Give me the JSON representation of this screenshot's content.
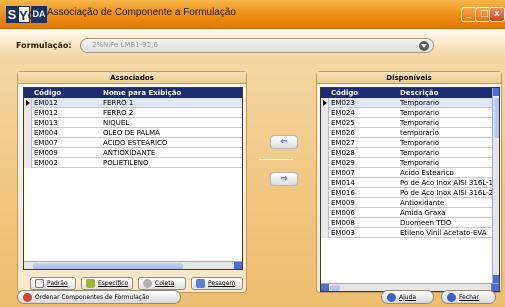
{
  "window": {
    "logo": [
      "S",
      "YC",
      "DA"
    ],
    "title": "Associação de Componente a Formulação",
    "buttons": {
      "minimize": "_",
      "maximize": "□",
      "close": "x"
    }
  },
  "formulacao": {
    "label": "Formulação:",
    "value": "2%NiFe LMB1-91,6"
  },
  "associados": {
    "title": "Associados",
    "columns": [
      "Código",
      "Nome para Exibição"
    ],
    "rows": [
      [
        "EM012",
        "FERRO 1"
      ],
      [
        "EM012",
        "FERRO 2"
      ],
      [
        "EM013",
        "NIQUEL"
      ],
      [
        "EM004",
        "OLEO DE PALMA"
      ],
      [
        "EM007",
        "ACIDO ESTEARICO"
      ],
      [
        "EM009",
        "ANTIOXIDANTE"
      ],
      [
        "EM002",
        "POLIETILENO"
      ]
    ],
    "selected_row": 0
  },
  "disponiveis": {
    "title": "Disponíveis",
    "columns": [
      "Código",
      "Descrição"
    ],
    "rows": [
      [
        "EM023",
        "Temporario"
      ],
      [
        "EM024",
        "Temporario"
      ],
      [
        "EM025",
        "Temporario"
      ],
      [
        "EM026",
        "temporario"
      ],
      [
        "EM027",
        "Temporario"
      ],
      [
        "EM028",
        "Temporario"
      ],
      [
        "EM029",
        "Temporario"
      ],
      [
        "EM007",
        "Acido Estearico"
      ],
      [
        "EM014",
        "Po de Aco Inox AISI 316L-15"
      ],
      [
        "EM016",
        "Po de Aco Inox AISI 316L-22"
      ],
      [
        "EM009",
        "Antioxidante"
      ],
      [
        "EM006",
        "Amida Graxa"
      ],
      [
        "EM008",
        "Duomeen TDO"
      ],
      [
        "EM003",
        "Etileno Vinil Acetato-EVA"
      ]
    ],
    "selected_row": 0
  },
  "bottom_buttons": {
    "padrao": "Padrão",
    "especifico": "Específico",
    "coleta": "Coleta",
    "pesagem": "Pesagem"
  },
  "transfer": {
    "left": "⇐",
    "right": "⇒"
  },
  "footer": {
    "ordenar": "Ordenar Componentes de Formulação",
    "ajuda": "Ajuda",
    "fechar": "Fechar"
  },
  "colors": {
    "titlebar": "#ee8c12",
    "grid_header": "#1c2d73",
    "body_bg": "#f0c680"
  }
}
